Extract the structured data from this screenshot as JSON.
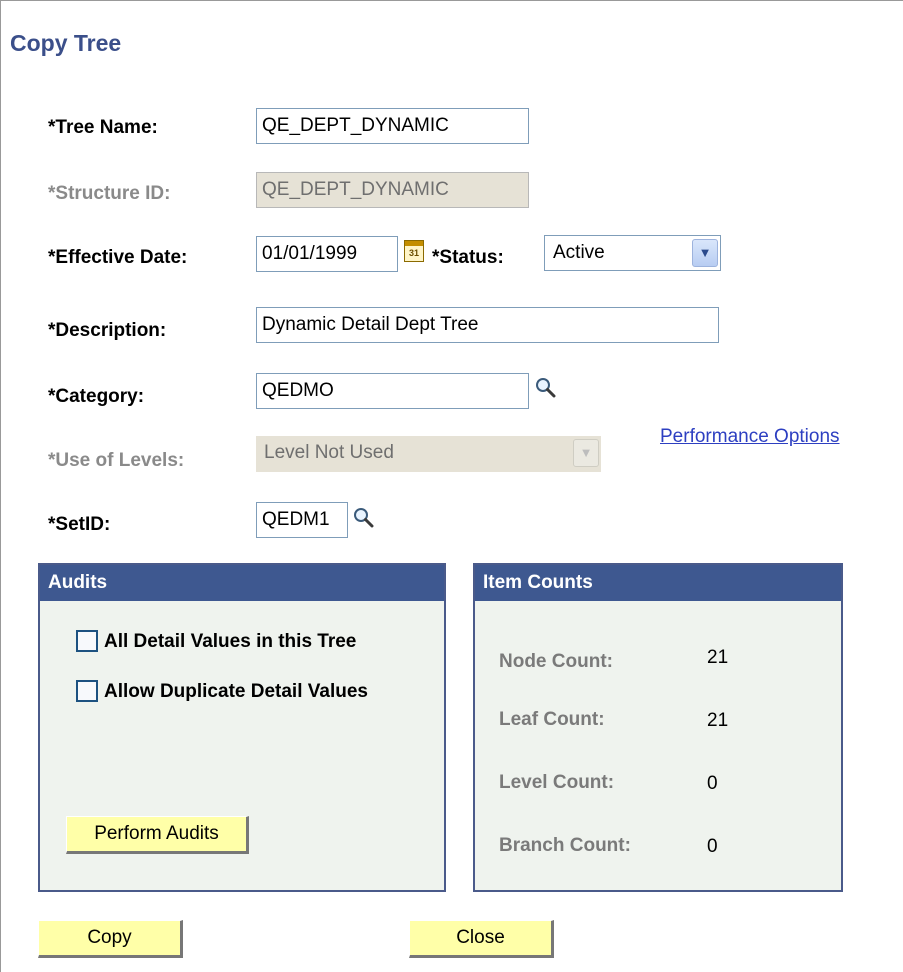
{
  "page": {
    "title": "Copy Tree"
  },
  "form": {
    "tree_name": {
      "label": "*Tree Name:",
      "value": "QE_DEPT_DYNAMIC"
    },
    "structure_id": {
      "label": "*Structure ID:",
      "value": "QE_DEPT_DYNAMIC"
    },
    "effective_date": {
      "label": "*Effective Date:",
      "value": "01/01/1999",
      "calendar_icon_text": "31"
    },
    "status": {
      "label": "*Status:",
      "value": "Active"
    },
    "description": {
      "label": "*Description:",
      "value": "Dynamic Detail Dept Tree"
    },
    "category": {
      "label": "*Category:",
      "value": "QEDMO"
    },
    "use_of_levels": {
      "label": "*Use of Levels:",
      "value": "Level Not Used"
    },
    "setid": {
      "label": "*SetID:",
      "value": "QEDM1"
    },
    "performance_options_link": "Performance Options"
  },
  "audits": {
    "title": "Audits",
    "checkboxes": [
      {
        "label": "All Detail Values in this Tree",
        "checked": false
      },
      {
        "label": "Allow Duplicate Detail Values",
        "checked": false
      }
    ],
    "button_label": "Perform Audits"
  },
  "item_counts": {
    "title": "Item Counts",
    "rows": [
      {
        "label": "Node Count:",
        "value": "21"
      },
      {
        "label": "Leaf Count:",
        "value": "21"
      },
      {
        "label": "Level Count:",
        "value": "0"
      },
      {
        "label": "Branch Count:",
        "value": "0"
      }
    ]
  },
  "footer": {
    "copy_label": "Copy",
    "close_label": "Close"
  },
  "icons": {
    "lookup": "magnifier-icon",
    "calendar": "calendar-icon",
    "dropdown": "chevron-down-icon"
  },
  "colors": {
    "title": "#3b4f8a",
    "box_header": "#3e5890",
    "button_bg": "#ffffa8",
    "link": "#2d3fc1"
  }
}
